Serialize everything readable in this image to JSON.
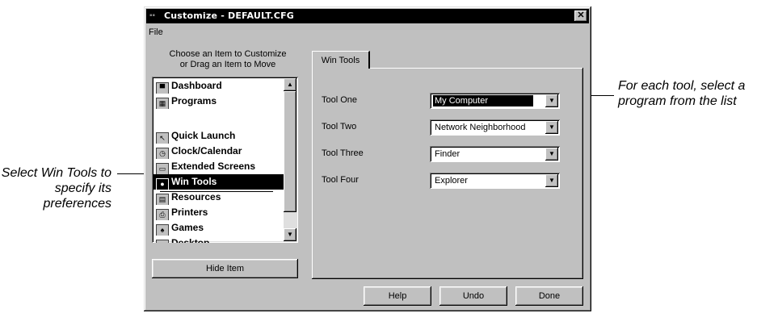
{
  "window": {
    "title": "Customize - DEFAULT.CFG",
    "close_label": "✕",
    "menu_file": "File"
  },
  "list": {
    "header_line1": "Choose an Item to Customize",
    "header_line2": "or Drag an Item to Move",
    "items": [
      {
        "label": "Dashboard",
        "icon": "dashboard-icon",
        "glyph": "▀"
      },
      {
        "label": "Programs",
        "icon": "programs-icon",
        "glyph": "▦"
      },
      {
        "label": "Quick Launch",
        "icon": "quick-launch-icon",
        "glyph": "↖"
      },
      {
        "label": "Clock/Calendar",
        "icon": "clock-icon",
        "glyph": "◷"
      },
      {
        "label": "Extended Screens",
        "icon": "extended-screens-icon",
        "glyph": "▭"
      },
      {
        "label": "Win Tools",
        "icon": "win-tools-icon",
        "glyph": "●",
        "selected": true
      },
      {
        "label": "Resources",
        "icon": "resources-icon",
        "glyph": "▤"
      },
      {
        "label": "Printers",
        "icon": "printers-icon",
        "glyph": "⎙"
      },
      {
        "label": "Games",
        "icon": "games-icon",
        "glyph": "♠"
      },
      {
        "label": "Desktop",
        "icon": "desktop-icon",
        "glyph": "▣"
      }
    ],
    "hide_button": "Hide Item"
  },
  "tabs": {
    "active": "Win Tools"
  },
  "tools": [
    {
      "label": "Tool One",
      "value": "My Computer",
      "selected": true
    },
    {
      "label": "Tool Two",
      "value": "Network Neighborhood"
    },
    {
      "label": "Tool Three",
      "value": "Finder"
    },
    {
      "label": "Tool Four",
      "value": "Explorer"
    }
  ],
  "buttons": {
    "help": "Help",
    "undo": "Undo",
    "done": "Done"
  },
  "callouts": {
    "left": "Select Win Tools to specify its preferences",
    "right": "For each tool, select a program from the list"
  }
}
